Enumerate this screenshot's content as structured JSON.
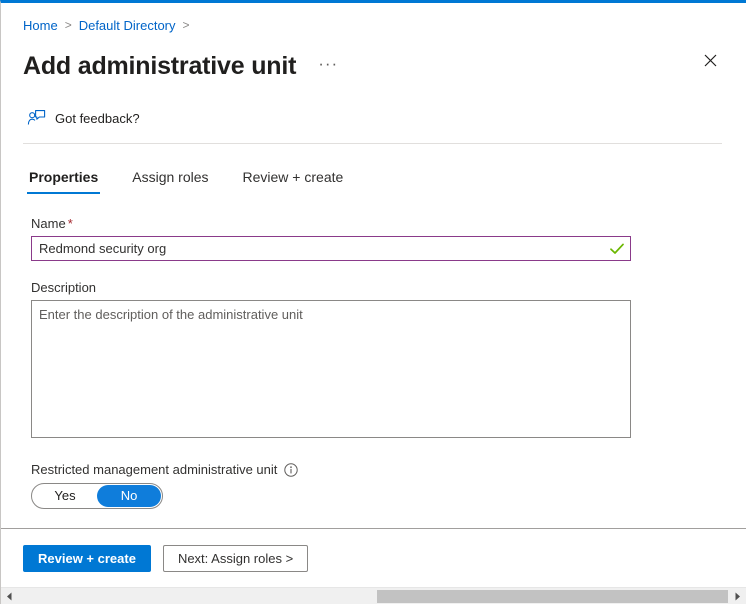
{
  "window": {
    "accent_color": "#0078d4"
  },
  "breadcrumb": {
    "items": [
      {
        "label": "Home"
      },
      {
        "label": "Default Directory"
      }
    ],
    "separator": ">"
  },
  "header": {
    "title": "Add administrative unit",
    "more_options": "···",
    "close_icon": "close-icon"
  },
  "feedback": {
    "label": "Got feedback?",
    "icon": "feedback-person-icon"
  },
  "tabs": [
    {
      "label": "Properties",
      "active": true
    },
    {
      "label": "Assign roles",
      "active": false
    },
    {
      "label": "Review + create",
      "active": false
    }
  ],
  "form": {
    "name": {
      "label": "Name",
      "required_marker": "*",
      "value": "Redmond security org",
      "placeholder": "",
      "validation_icon": "green-check-icon",
      "border_color": "#8a3a8a"
    },
    "description": {
      "label": "Description",
      "value": "",
      "placeholder": "Enter the description of the administrative unit"
    },
    "restricted": {
      "label": "Restricted management administrative unit",
      "info_icon": "info-icon",
      "options": [
        "Yes",
        "No"
      ],
      "selected": "No",
      "selected_color": "#0f7ddb"
    }
  },
  "footer": {
    "primary_label": "Review + create",
    "secondary_label": "Next: Assign roles >"
  },
  "scrollbar": {
    "left_arrow": "chevron-left-icon",
    "right_arrow": "chevron-right-icon"
  }
}
